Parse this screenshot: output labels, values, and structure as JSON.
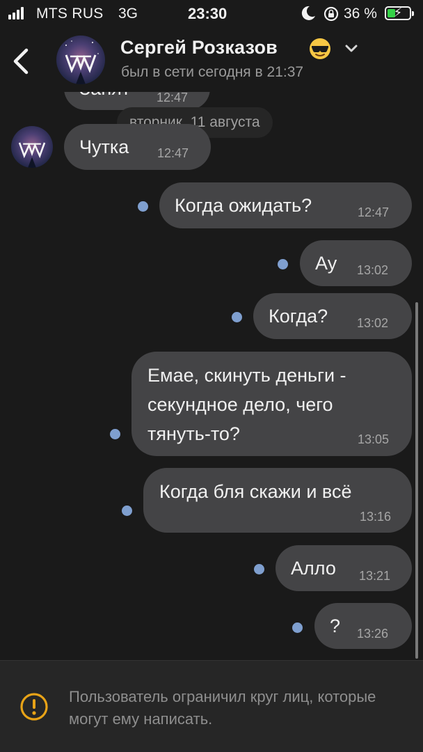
{
  "status_bar": {
    "carrier": "MTS RUS",
    "network": "3G",
    "time": "23:30",
    "battery": "36 %",
    "battery_color": "#35d147",
    "icons": [
      "signal-icon",
      "moon-icon",
      "rotation-lock-icon",
      "battery-icon"
    ]
  },
  "header": {
    "name": "Сергей Розказов",
    "emoji": "😎",
    "status": "был в сети сегодня в 21:37",
    "icons": [
      "back-icon",
      "chevron-down-icon"
    ]
  },
  "chat": {
    "partial_message": {
      "text": "Занят",
      "time": "12:47"
    },
    "date_separator": "вторник, 11 августа",
    "messages": [
      {
        "side": "in",
        "text": "Чутка",
        "time": "12:47"
      },
      {
        "side": "out",
        "text": "Когда ожидать?",
        "time": "12:47",
        "unread": true
      },
      {
        "side": "out",
        "text": "Ау",
        "time": "13:02",
        "unread": true
      },
      {
        "side": "out",
        "text": "Когда?",
        "time": "13:02",
        "unread": true
      },
      {
        "side": "out",
        "text": "Емае, скинуть деньги -\nсекундное дело, чего\nтянуть-то?",
        "time": "13:05",
        "unread": true
      },
      {
        "side": "out",
        "text": "Когда бля скажи и всё",
        "time": "13:16",
        "unread": true
      },
      {
        "side": "out",
        "text": "Алло",
        "time": "13:21",
        "unread": true
      },
      {
        "side": "out",
        "text": "?",
        "time": "13:26",
        "unread": true
      }
    ]
  },
  "notice": {
    "icon": "warning-icon",
    "text": "Пользователь ограничил круг лиц, которые могут ему написать."
  },
  "colors": {
    "background": "#1a1a1a",
    "bubble": "#444446",
    "unread_dot": "#7f9fcf",
    "notice_bar": "#262626"
  }
}
